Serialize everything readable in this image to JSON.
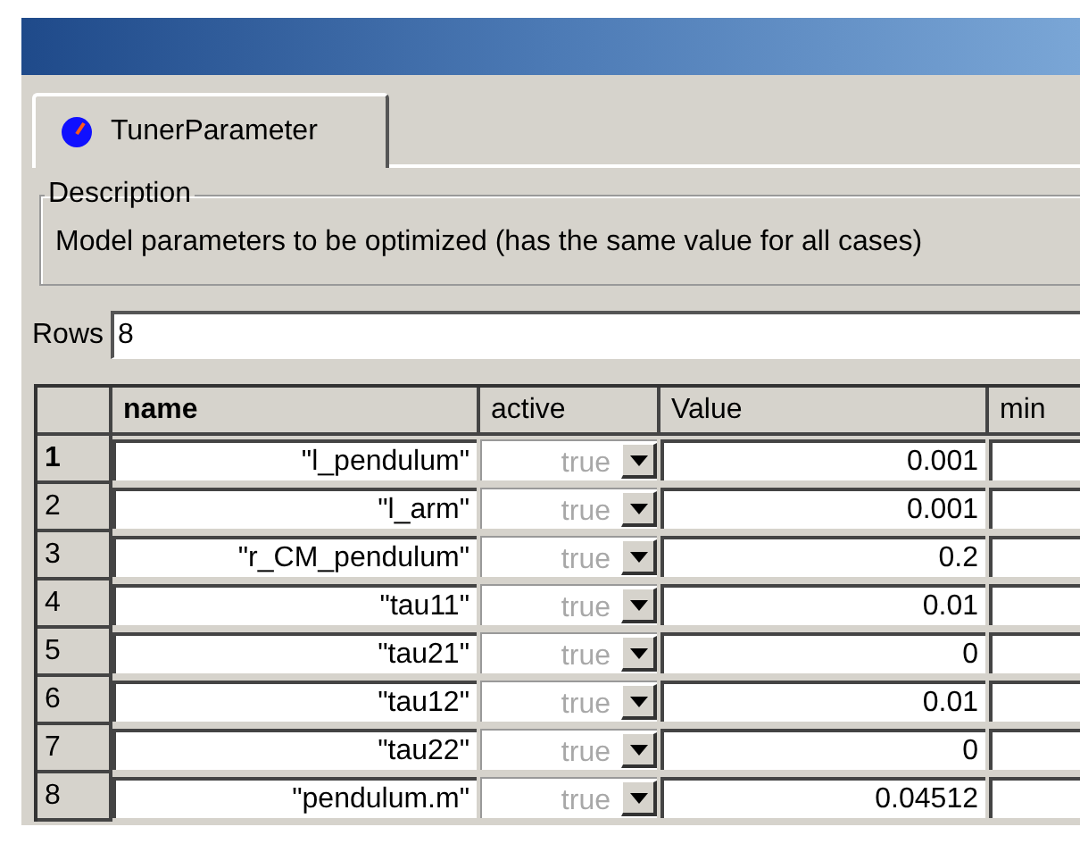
{
  "tabs": [
    {
      "label": "TunerParameter",
      "selected": true
    }
  ],
  "description": {
    "legend": "Description",
    "text": "Model parameters to be optimized (has the same value for all cases)"
  },
  "rows_field": {
    "label": "Rows",
    "value": "8"
  },
  "table": {
    "columns": [
      "name",
      "active",
      "Value",
      "min"
    ],
    "rows": [
      {
        "index": "1",
        "selected": true,
        "name": "\"l_pendulum\"",
        "active": "true",
        "active_disabled": true,
        "value": "0.001"
      },
      {
        "index": "2",
        "selected": false,
        "name": "\"l_arm\"",
        "active": "true",
        "active_disabled": true,
        "value": "0.001"
      },
      {
        "index": "3",
        "selected": false,
        "name": "\"r_CM_pendulum\"",
        "active": "true",
        "active_disabled": true,
        "value": "0.2"
      },
      {
        "index": "4",
        "selected": false,
        "name": "\"tau11\"",
        "active": "true",
        "active_disabled": true,
        "value": "0.01"
      },
      {
        "index": "5",
        "selected": false,
        "name": "\"tau21\"",
        "active": "true",
        "active_disabled": true,
        "value": "0"
      },
      {
        "index": "6",
        "selected": false,
        "name": "\"tau12\"",
        "active": "true",
        "active_disabled": true,
        "value": "0.01"
      },
      {
        "index": "7",
        "selected": false,
        "name": "\"tau22\"",
        "active": "true",
        "active_disabled": true,
        "value": "0"
      },
      {
        "index": "8",
        "selected": false,
        "name": "\"pendulum.m\"",
        "active": "true",
        "active_disabled": true,
        "value": "0.04512"
      }
    ]
  }
}
